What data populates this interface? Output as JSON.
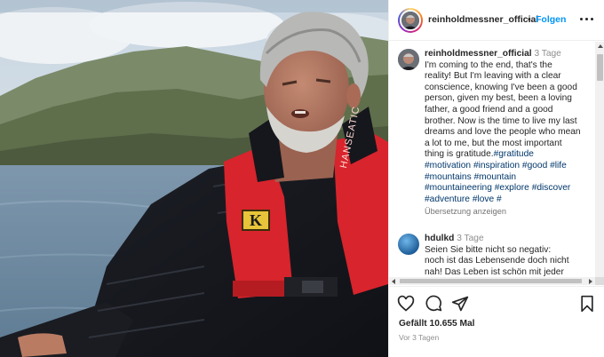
{
  "post": {
    "username": "reinholdmessner_official",
    "separator": "•",
    "follow_label": "Folgen",
    "more_icon": "more-horizontal-icon"
  },
  "caption": {
    "username": "reinholdmessner_official",
    "time": "3 Tage",
    "lines": [
      "I'm coming to the end, that's the",
      "reality! But I'm leaving with a clear",
      "conscience, knowing I've been a good",
      "person, given my best, been a loving",
      "father, a good friend and a good",
      "brother. Now is the time to live my last",
      "dreams and love the people who mean",
      "a lot to me, but the most important"
    ],
    "last_line_text": "thing is gratitude.",
    "hashtags": [
      "#gratitude",
      "#motivation",
      "#inspiration",
      "#good",
      "#life",
      "#mountains",
      "#mountain",
      "#mountaineering",
      "#explore",
      "#discover",
      "#adventure",
      "#love",
      "#"
    ],
    "translate_label": "Übersetzung anzeigen"
  },
  "comment": {
    "username": "hdulkd",
    "time": "3 Tage",
    "lines": [
      "Seien Sie bitte nicht so negativ:",
      "noch ist das Lebensende doch nicht",
      "nah! Das Leben ist schön mit jeder"
    ]
  },
  "actions": {
    "like_icon": "heart-icon",
    "comment_icon": "comment-icon",
    "share_icon": "paper-plane-icon",
    "save_icon": "bookmark-icon"
  },
  "likes_label": "Gefällt 10.655 Mal",
  "posted_ago": "Vor 3 Tagen",
  "photo": {
    "vest_badge": "K",
    "vest_text": "HANSEATIC"
  },
  "colors": {
    "accent": "#0095f6",
    "hashtag": "#00376b",
    "vest_red": "#d8242c"
  }
}
